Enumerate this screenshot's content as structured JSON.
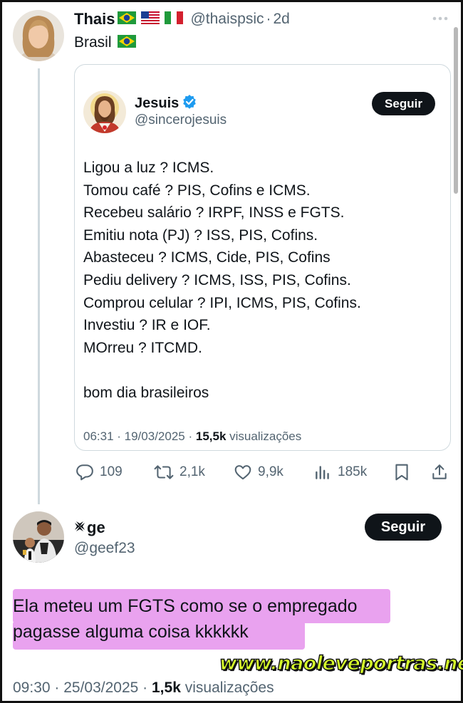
{
  "main_tweet": {
    "author_name": "Thais",
    "author_handle": "@thaispsic",
    "separator": "·",
    "time_ago": "2d",
    "more_icon": "more-horizontal-icon",
    "text": "Brasil"
  },
  "quoted_tweet": {
    "author_name": "Jesuis",
    "author_handle": "@sincerojesuis",
    "follow_label": "Seguir",
    "lines": [
      "Ligou a luz ? ICMS.",
      "Tomou café ? PIS, Cofins e ICMS.",
      "Recebeu salário ? IRPF, INSS e FGTS.",
      "Emitiu nota (PJ) ? ISS, PIS, Cofins.",
      "Abasteceu ? ICMS, Cide, PIS, Cofins",
      "Pediu delivery ? ICMS, ISS, PIS, Cofins.",
      "Comprou celular ? IPI, ICMS, PIS, Cofins.",
      "Investiu ? IR e IOF.",
      "MOrreu ? ITCMD."
    ],
    "closing": "bom dia brasileiros",
    "time": "06:31 · 19/03/2025 ·",
    "views_count": "15,5k",
    "views_label": "visualizações"
  },
  "actions": {
    "replies": "109",
    "reposts": "2,1k",
    "likes": "9,9k",
    "views": "185k"
  },
  "reply_tweet": {
    "author_name": "ge",
    "author_handle": "@geef23",
    "follow_label": "Seguir",
    "line1": "Ela meteu um FGTS como se o empregado",
    "line2": "pagasse alguma coisa kkkkkk",
    "time": "09:30 · 25/03/2025 ·",
    "views_count": "1,5k",
    "views_label": "visualizações"
  },
  "watermark": "www.naoleveportras.net",
  "colors": {
    "highlight": "#e9a2ef",
    "verified": "#1d9bf0",
    "watermark": "#d7ff2a",
    "follow_bg": "#0f1419"
  }
}
